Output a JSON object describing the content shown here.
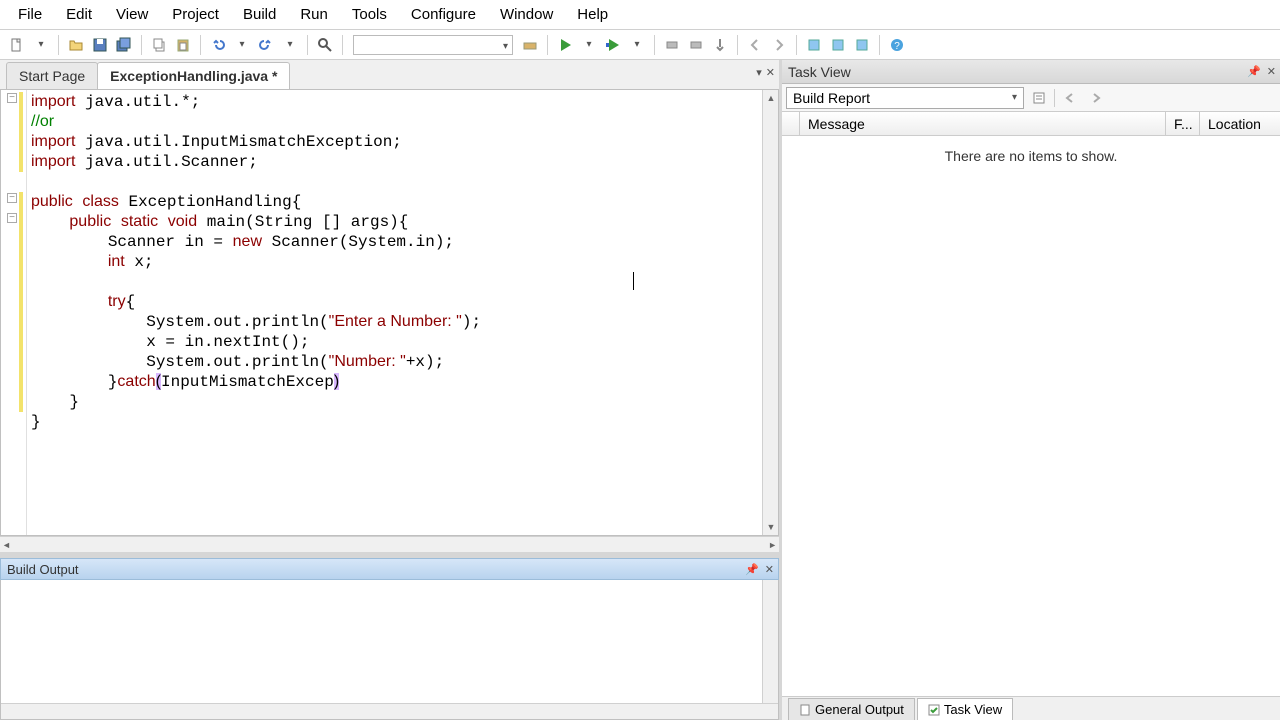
{
  "menu": {
    "items": [
      "File",
      "Edit",
      "View",
      "Project",
      "Build",
      "Run",
      "Tools",
      "Configure",
      "Window",
      "Help"
    ]
  },
  "toolbar": {
    "dropdown": ""
  },
  "editor": {
    "tabs": [
      {
        "label": "Start Page"
      },
      {
        "label": "ExceptionHandling.java *"
      }
    ],
    "code_lines": [
      "import java.util.*;",
      "//or",
      "import java.util.InputMismatchException;",
      "import java.util.Scanner;",
      "",
      "public class ExceptionHandling{",
      "    public static void main(String [] args){",
      "        Scanner in = new Scanner(System.in);",
      "        int x;",
      "",
      "        try{",
      "            System.out.println(\"Enter a Number: \");",
      "            x = in.nextInt();",
      "            System.out.println(\"Number: \"+x);",
      "        }catch(InputMismatchExcep)",
      "    }",
      "}"
    ]
  },
  "build_output": {
    "title": "Build Output"
  },
  "task_view": {
    "title": "Task View",
    "dropdown": "Build Report",
    "columns": [
      "Message",
      "F...",
      "Location"
    ],
    "empty_msg": "There are no items to show.",
    "tabs": [
      {
        "label": "General Output"
      },
      {
        "label": "Task View"
      }
    ]
  }
}
